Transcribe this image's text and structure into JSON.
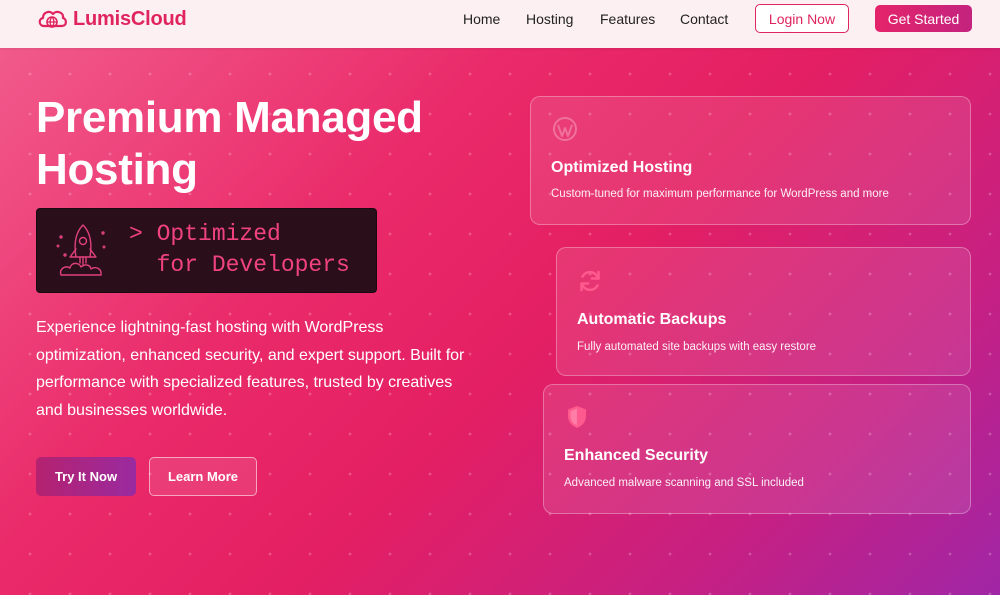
{
  "brand": {
    "name": "LumisCloud",
    "icon": "cloud-globe-icon"
  },
  "nav": {
    "items": [
      "Home",
      "Hosting",
      "Features",
      "Contact"
    ],
    "login_label": "Login Now",
    "cta_label": "Get Started"
  },
  "hero": {
    "title": "Premium Managed Hosting",
    "terminal": {
      "icon": "rocket-icon",
      "text": "> Optimized\n  for Developers"
    },
    "description": "Experience lightning-fast hosting with WordPress optimization, enhanced security, and expert support. Built for performance with specialized features, trusted by creatives and businesses worldwide.",
    "primary_button": "Try It Now",
    "secondary_button": "Learn More"
  },
  "features": [
    {
      "icon": "wordpress-icon",
      "title": "Optimized Hosting",
      "description": "Custom-tuned for maximum performance for WordPress and more"
    },
    {
      "icon": "refresh-icon",
      "title": "Automatic Backups",
      "description": "Fully automated site backups with easy restore"
    },
    {
      "icon": "shield-icon",
      "title": "Enhanced Security",
      "description": "Advanced malware scanning and SSL included"
    }
  ],
  "colors": {
    "accent": "#e0245e",
    "header_bg": "#fdf0f3",
    "terminal_bg": "#2a0f1b",
    "terminal_text": "#f0427f"
  }
}
